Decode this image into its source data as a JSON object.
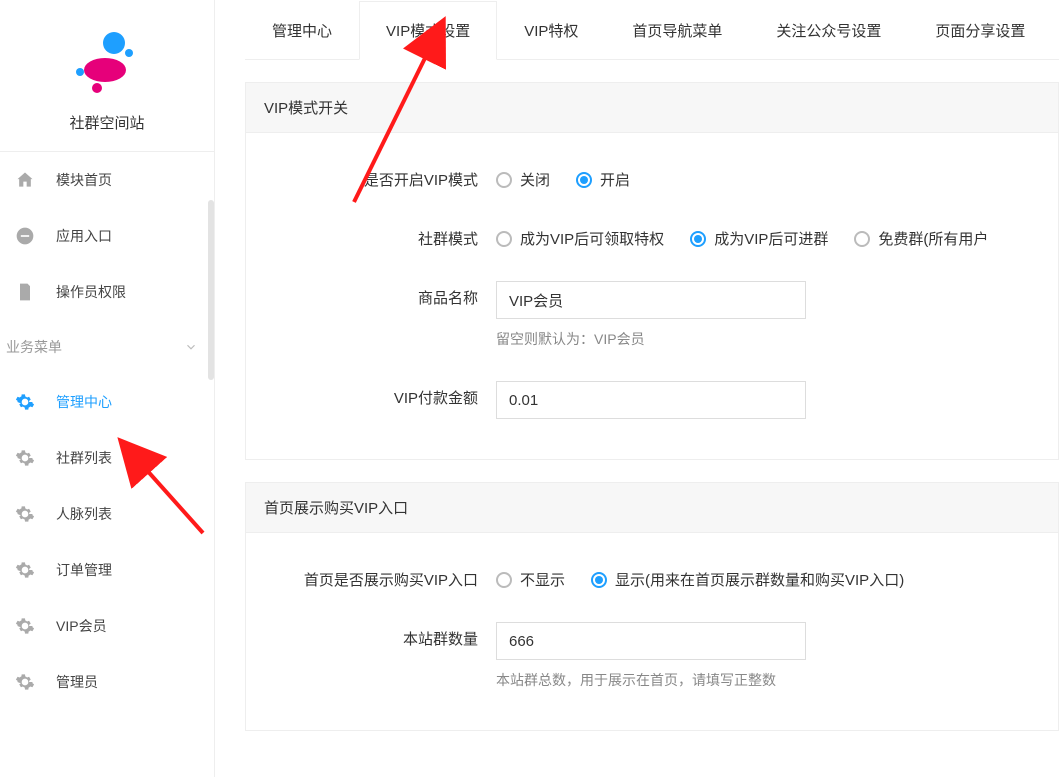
{
  "sidebar": {
    "app_title": "社群空间站",
    "nav": [
      {
        "label": "模块首页",
        "icon": "home-icon"
      },
      {
        "label": "应用入口",
        "icon": "chat-icon"
      },
      {
        "label": "操作员权限",
        "icon": "doc-icon"
      }
    ],
    "group_title": "业务菜单",
    "biz": [
      {
        "label": "管理中心",
        "active": true
      },
      {
        "label": "社群列表",
        "active": false
      },
      {
        "label": "人脉列表",
        "active": false
      },
      {
        "label": "订单管理",
        "active": false
      },
      {
        "label": "VIP会员",
        "active": false
      },
      {
        "label": "管理员",
        "active": false
      }
    ]
  },
  "tabs": [
    {
      "label": "管理中心",
      "active": false
    },
    {
      "label": "VIP模式设置",
      "active": true
    },
    {
      "label": "VIP特权",
      "active": false
    },
    {
      "label": "首页导航菜单",
      "active": false
    },
    {
      "label": "关注公众号设置",
      "active": false
    },
    {
      "label": "页面分享设置",
      "active": false
    }
  ],
  "section_vip": {
    "title": "VIP模式开关",
    "rows": {
      "enable": {
        "label": "是否开启VIP模式",
        "options": [
          {
            "text": "关闭",
            "checked": false
          },
          {
            "text": "开启",
            "checked": true
          }
        ]
      },
      "mode": {
        "label": "社群模式",
        "options": [
          {
            "text": "成为VIP后可领取特权",
            "checked": false
          },
          {
            "text": "成为VIP后可进群",
            "checked": true
          },
          {
            "text": "免费群(所有用户",
            "checked": false
          }
        ]
      },
      "product": {
        "label": "商品名称",
        "value": "VIP会员",
        "hint": "留空则默认为：VIP会员"
      },
      "price": {
        "label": "VIP付款金额",
        "value": "0.01"
      }
    }
  },
  "section_home": {
    "title": "首页展示购买VIP入口",
    "rows": {
      "show": {
        "label": "首页是否展示购买VIP入口",
        "options": [
          {
            "text": "不显示",
            "checked": false
          },
          {
            "text": "显示(用来在首页展示群数量和购买VIP入口)",
            "checked": true
          }
        ]
      },
      "count": {
        "label": "本站群数量",
        "value": "666",
        "hint": "本站群总数，用于展示在首页，请填写正整数"
      }
    }
  }
}
